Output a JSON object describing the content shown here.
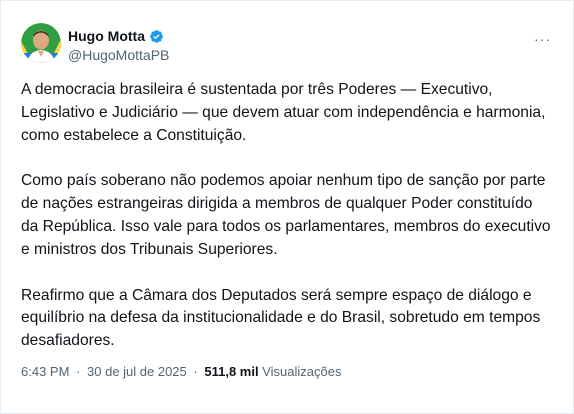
{
  "author": {
    "name": "Hugo Motta",
    "handle": "@HugoMottaPB",
    "verified": true,
    "verified_color": "#1d9bf0"
  },
  "menu": {
    "icon": "more-horizontal-icon",
    "glyph": "···"
  },
  "tweet": {
    "paragraphs": [
      "A democracia brasileira é sustentada por três Poderes — Executivo, Legislativo e Judiciário — que devem atuar com independência e harmonia, como estabelece a Constituição.",
      "Como país soberano não podemos apoiar nenhum tipo de sanção por parte de nações estrangeiras dirigida a membros de qualquer Poder constituído da República. Isso vale para todos os parlamentares, membros do executivo e ministros dos Tribunais Superiores.",
      "Reafirmo que a Câmara dos Deputados será sempre espaço de diálogo e equilíbrio na defesa da institucionalidade e do Brasil, sobretudo em tempos desafiadores."
    ]
  },
  "meta": {
    "time": "6:43 PM",
    "separator": "·",
    "date": "30 de jul de 2025",
    "views_count": "511,8 mil",
    "views_label": "Visualizações"
  }
}
